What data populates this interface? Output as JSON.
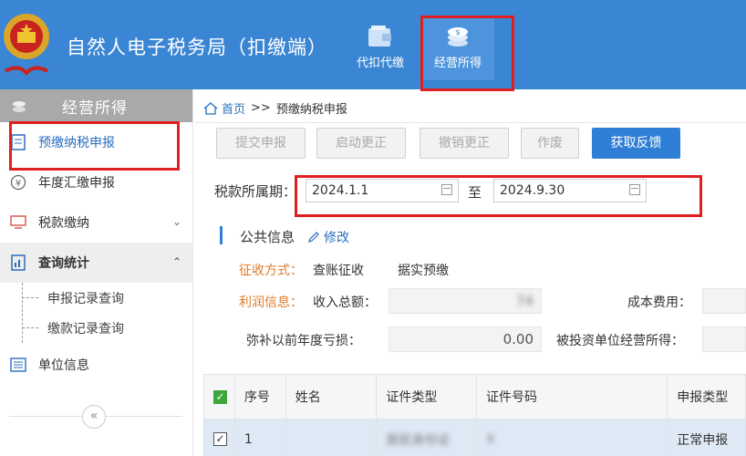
{
  "header": {
    "app_title": "自然人电子税务局（扣缴端）",
    "tabs": [
      {
        "label": "代扣代缴",
        "icon": "wallet-icon"
      },
      {
        "label": "经营所得",
        "icon": "coins-icon"
      }
    ]
  },
  "sidebar": {
    "title": "经营所得",
    "items": [
      {
        "label": "预缴纳税申报",
        "icon": "form-icon"
      },
      {
        "label": "年度汇缴申报",
        "icon": "yen-icon"
      },
      {
        "label": "税款缴纳",
        "icon": "monitor-icon"
      },
      {
        "label": "查询统计",
        "icon": "chart-doc-icon"
      },
      {
        "label": "单位信息",
        "icon": "list-icon"
      }
    ],
    "sub_items": [
      "申报记录查询",
      "缴款记录查询"
    ],
    "collapse": "«"
  },
  "breadcrumb": {
    "home": "首页",
    "separator": ">>",
    "current": "预缴纳税申报"
  },
  "toolbar": {
    "submit": "提交申报",
    "start_correction": "启动更正",
    "cancel_correction": "撤销更正",
    "void": "作废",
    "get_feedback": "获取反馈"
  },
  "period": {
    "label": "税款所属期：",
    "start": "2024.1.1",
    "to": "至",
    "end": "2024.9.30"
  },
  "public_info": {
    "title": "公共信息",
    "edit": "修改"
  },
  "levy": {
    "label": "征收方式：",
    "method": "查账征收",
    "type": "据实预缴"
  },
  "profit": {
    "label": "利润信息：",
    "total_income_label": "收入总额：",
    "total_income_value": "74",
    "cost_label": "成本费用：",
    "loss_label": "弥补以前年度亏损：",
    "loss_value": "0.00",
    "investee_label": "被投资单位经营所得："
  },
  "table": {
    "headers": [
      "序号",
      "姓名",
      "证件类型",
      "证件号码",
      "申报类型"
    ],
    "rows": [
      {
        "index": "1",
        "name": "",
        "id_type": "居民身份证",
        "id_number": "X",
        "declare_type": "正常申报"
      }
    ]
  },
  "colors": {
    "header_bg": "#3a86d4",
    "accent": "#2f7fd6",
    "highlight_box": "#e02020",
    "label_orange": "#e07b2a"
  }
}
